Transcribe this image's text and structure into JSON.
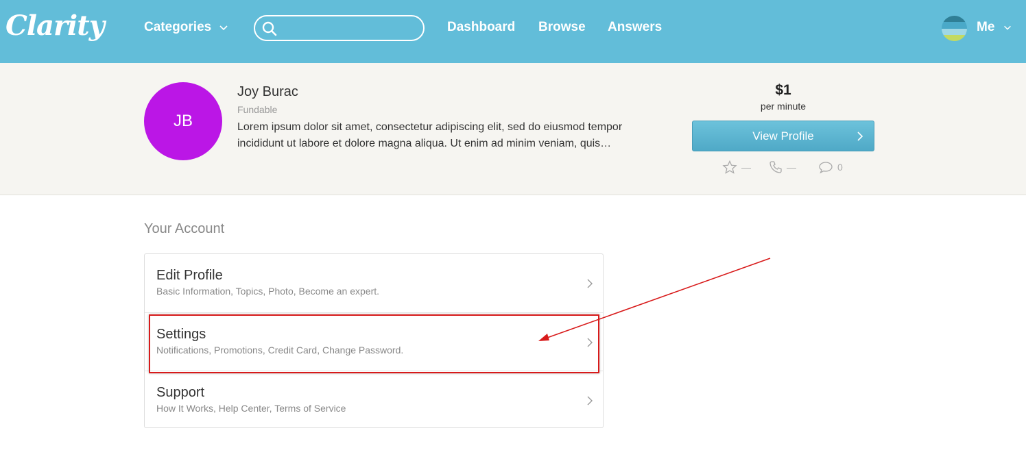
{
  "header": {
    "logo": "Clarity",
    "categories_label": "Categories",
    "search_placeholder": "",
    "nav": {
      "dashboard": "Dashboard",
      "browse": "Browse",
      "answers": "Answers"
    },
    "me_label": "Me",
    "colors": {
      "bar": "#62bdd9",
      "text": "#ffffff"
    }
  },
  "profile": {
    "initials": "JB",
    "name": "Joy Burac",
    "status": "Fundable",
    "bio": "Lorem ipsum dolor sit amet, consectetur adipiscing elit, sed do eiusmod tempor incididunt ut labore et dolore magna aliqua. Ut enim ad minim veniam, quis…",
    "rate": "$1",
    "rate_unit": "per minute",
    "view_profile_label": "View Profile",
    "stats": {
      "rating": "—",
      "calls": "—",
      "reviews": "0"
    },
    "avatar_color": "#bb16e6"
  },
  "account": {
    "title": "Your Account",
    "items": [
      {
        "title": "Edit Profile",
        "subtitle": "Basic Information, Topics, Photo, Become an expert."
      },
      {
        "title": "Settings",
        "subtitle": "Notifications, Promotions, Credit Card, Change Password."
      },
      {
        "title": "Support",
        "subtitle": "How It Works, Help Center, Terms of Service"
      }
    ]
  },
  "annotation": {
    "color": "#d81a1a",
    "target": "Settings"
  }
}
